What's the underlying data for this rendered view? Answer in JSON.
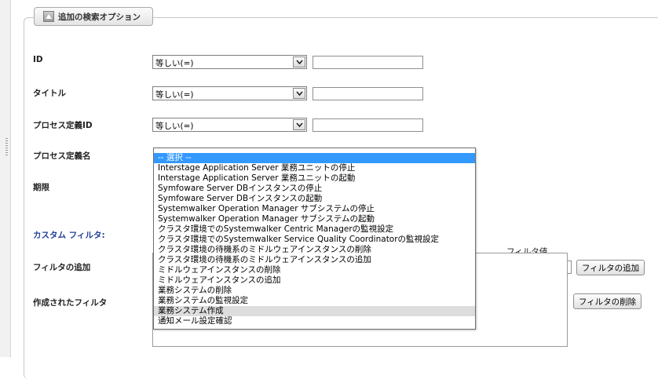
{
  "section": {
    "legend": "追加の検索オプション"
  },
  "fields": {
    "id_label": "ID",
    "title_label": "タイトル",
    "process_def_id_label": "プロセス定義ID",
    "process_def_name_label": "プロセス定義名",
    "deadline_label": "期限",
    "custom_filter_label": "カスタム フィルタ:",
    "add_filter_label": "フィルタの追加",
    "created_filter_label": "作成されたフィルタ",
    "operator_selected": "等しい(=)",
    "filter_value_label": "フィルタ値"
  },
  "buttons": {
    "add_filter": "フィルタの追加",
    "delete_filter": "フィルタの削除"
  },
  "dropdown": {
    "options": [
      "-- 選択 --",
      "Interstage Application Server 業務ユニットの停止",
      "Interstage Application Server 業務ユニットの起動",
      "Symfoware Server DBインスタンスの停止",
      "Symfoware Server DBインスタンスの起動",
      "Systemwalker Operation Manager サブシステムの停止",
      "Systemwalker Operation Manager サブシステムの起動",
      "クラスタ環境でのSystemwalker Centric Managerの監視設定",
      "クラスタ環境でのSystemwalker Service Quality Coordinatorの監視設定",
      "クラスタ環境の待機系のミドルウェアインスタンスの削除",
      "クラスタ環境の待機系のミドルウェアインスタンスの追加",
      "ミドルウェアインスタンスの削除",
      "ミドルウェアインスタンスの追加",
      "業務システムの削除",
      "業務システムの監視設定",
      "業務システム作成",
      "通知メール設定確認"
    ],
    "selected_index": 0,
    "hover_index": 15
  },
  "colors": {
    "selected_option": "#3399ff",
    "hover_option": "#dddddd",
    "custom_filter_label": "#1f3f99"
  }
}
